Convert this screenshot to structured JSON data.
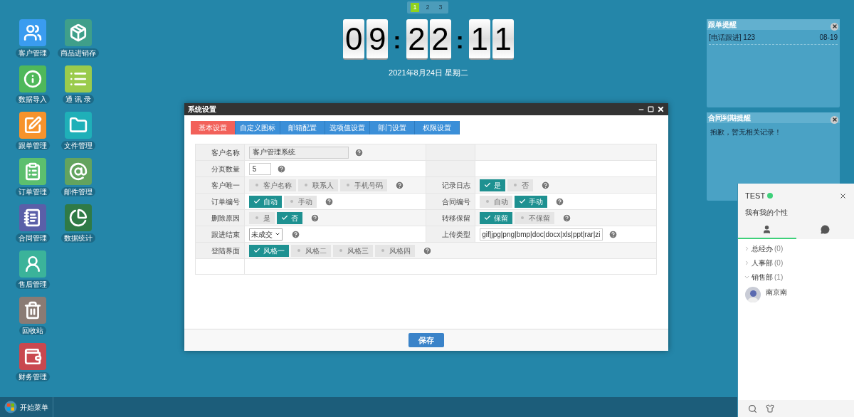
{
  "page_switcher": [
    {
      "label": "1",
      "selected": true
    },
    {
      "label": "2",
      "selected": false
    },
    {
      "label": "3",
      "selected": false
    }
  ],
  "clock": {
    "groups": [
      "09",
      "22",
      "11"
    ],
    "separators": [
      ":",
      ":"
    ],
    "date": "2021年8月24日 星期二"
  },
  "desktop_icons": {
    "columns": [
      [
        {
          "label": "客户管理",
          "color": "#3a9cf0"
        },
        {
          "label": "数据导入",
          "color": "#4fb85a"
        },
        {
          "label": "跟单管理",
          "color": "#f7932c"
        },
        {
          "label": "订单管理",
          "color": "#5cbf6e"
        },
        {
          "label": "合同管理",
          "color": "#5a5fa8"
        },
        {
          "label": "售后管理",
          "color": "#3bb39a"
        },
        {
          "label": "回收站",
          "color": "#8a7b74"
        },
        {
          "label": "财务管理",
          "color": "#c9484f"
        }
      ],
      [
        {
          "label": "商品进销存",
          "color": "#3f9f8a"
        },
        {
          "label": "通 讯 录",
          "color": "#9acb4c"
        },
        {
          "label": "文件管理",
          "color": "#1fb0b8"
        },
        {
          "label": "邮件管理",
          "color": "#63a35e"
        },
        {
          "label": "数据统计",
          "color": "#2f7a46"
        }
      ]
    ]
  },
  "dialog": {
    "title": "系统设置",
    "tabs": [
      {
        "label": "基本设置",
        "selected": true
      },
      {
        "label": "自定义图标",
        "selected": false
      },
      {
        "label": "邮箱配置",
        "selected": false
      },
      {
        "label": "选项值设置",
        "selected": false
      },
      {
        "label": "部门设置",
        "selected": false
      },
      {
        "label": "权限设置",
        "selected": false
      }
    ],
    "rows": [
      {
        "left": {
          "label": "客户名称",
          "kind": "text",
          "value": "客户管理系统",
          "disabled": true
        }
      },
      {
        "left": {
          "label": "分页数量",
          "kind": "text",
          "value": "5",
          "disabled": false
        }
      },
      {
        "left": {
          "label": "客户唯一",
          "kind": "options",
          "options": [
            {
              "label": "客户名称",
              "selected": false
            },
            {
              "label": "联系人",
              "selected": false
            },
            {
              "label": "手机号码",
              "selected": false
            }
          ]
        },
        "right": {
          "label": "记录日志",
          "kind": "options",
          "options": [
            {
              "label": "是",
              "selected": true
            },
            {
              "label": "否",
              "selected": false
            }
          ]
        }
      },
      {
        "left": {
          "label": "订单编号",
          "kind": "options",
          "options": [
            {
              "label": "自动",
              "selected": true
            },
            {
              "label": "手动",
              "selected": false
            }
          ]
        },
        "right": {
          "label": "合同编号",
          "kind": "options",
          "options": [
            {
              "label": "自动",
              "selected": false
            },
            {
              "label": "手动",
              "selected": true
            }
          ]
        }
      },
      {
        "left": {
          "label": "删除原因",
          "kind": "options",
          "options": [
            {
              "label": "是",
              "selected": false
            },
            {
              "label": "否",
              "selected": true
            }
          ]
        },
        "right": {
          "label": "转移保留",
          "kind": "options",
          "options": [
            {
              "label": "保留",
              "selected": true
            },
            {
              "label": "不保留",
              "selected": false
            }
          ]
        }
      },
      {
        "left": {
          "label": "跟进结束",
          "kind": "select",
          "value": "未成交"
        },
        "right": {
          "label": "上传类型",
          "kind": "wide_text",
          "value": "gif|jpg|png|bmp|doc|docx|xls|ppt|rar|zi"
        }
      },
      {
        "full": {
          "label": "登陆界面",
          "kind": "options",
          "options": [
            {
              "label": "风格一",
              "selected": true
            },
            {
              "label": "风格二",
              "selected": false
            },
            {
              "label": "风格三",
              "selected": false
            },
            {
              "label": "风格四",
              "selected": false
            }
          ]
        }
      }
    ],
    "save_button": "保存"
  },
  "reminders": [
    {
      "title": "跟单提醒",
      "items": [
        {
          "text": "[电话跟进] 123",
          "date": "08-19"
        }
      ]
    },
    {
      "title": "合同到期提醒",
      "empty_text": "抱歉，暂无相关记录！"
    }
  ],
  "chat": {
    "name": "TEST",
    "online": true,
    "signature": "我有我的个性",
    "tabs": [
      {
        "kind": "contacts",
        "selected": true
      },
      {
        "kind": "messages",
        "selected": false
      }
    ],
    "groups": [
      {
        "name": "总经办",
        "count": "(0)",
        "expanded": false
      },
      {
        "name": "人事部",
        "count": "(0)",
        "expanded": false
      },
      {
        "name": "销售部",
        "count": "(1)",
        "expanded": true,
        "children": [
          {
            "name": "南京南"
          }
        ]
      }
    ]
  },
  "taskbar": {
    "start_label": "开始菜单"
  }
}
